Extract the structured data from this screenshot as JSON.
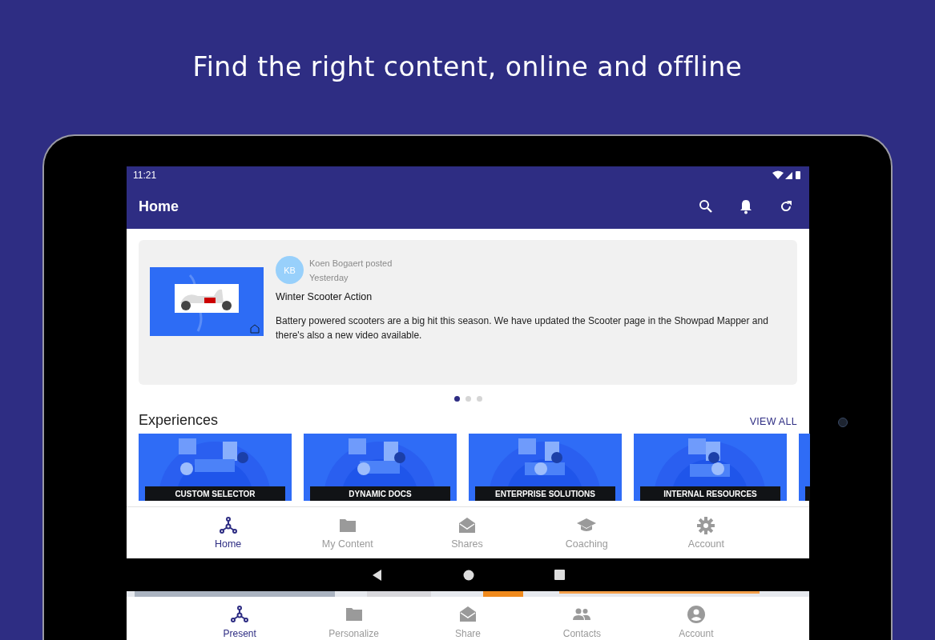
{
  "headline": "Find the right content, online and offline",
  "status_bar": {
    "time": "11:21"
  },
  "app_bar": {
    "title": "Home"
  },
  "post": {
    "avatar": "KB",
    "author": "Koen Bogaert posted",
    "time": "Yesterday",
    "title": "Winter Scooter Action",
    "body": "Battery powered scooters are a big hit this season. We have updated the Scooter page in the Showpad Mapper and there's also a new video available."
  },
  "carousel_dots": [
    {
      "selected": true
    },
    {
      "selected": false
    },
    {
      "selected": false
    }
  ],
  "experiences": {
    "title": "Experiences",
    "view_all": "VIEW ALL",
    "tiles": [
      {
        "title": "CUSTOM SELECTOR"
      },
      {
        "title": "DYNAMIC DOCS"
      },
      {
        "title": "ENTERPRISE SOLUTIONS"
      },
      {
        "title": "INTERNAL RESOURCES"
      }
    ]
  },
  "bottom_nav": [
    {
      "kind": "present",
      "label": "Home",
      "selected": true
    },
    {
      "kind": "folder",
      "label": "My Content",
      "selected": false
    },
    {
      "kind": "mail",
      "label": "Shares",
      "selected": false
    },
    {
      "kind": "cap",
      "label": "Coaching",
      "selected": false
    },
    {
      "kind": "gear",
      "label": "Account",
      "selected": false
    }
  ],
  "second_nav": [
    {
      "kind": "present",
      "label": "Present",
      "selected": true
    },
    {
      "kind": "folder",
      "label": "Personalize",
      "selected": false
    },
    {
      "kind": "mail",
      "label": "Share",
      "selected": false
    },
    {
      "kind": "people",
      "label": "Contacts",
      "selected": false
    },
    {
      "kind": "person",
      "label": "Account",
      "selected": false
    }
  ]
}
